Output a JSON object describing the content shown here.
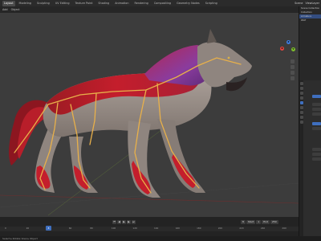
{
  "topbar": {
    "tabs": [
      "Layout",
      "Modeling",
      "Sculpting",
      "UV Editing",
      "Texture Paint",
      "Shading",
      "Animation",
      "Rendering",
      "Compositing",
      "Geometry Nodes",
      "Scripting"
    ],
    "active_tab": 0,
    "scene_label": "Scene",
    "layer_label": "ViewLayer"
  },
  "viewport_header": {
    "items": [
      "Add",
      "Object"
    ]
  },
  "gizmo": {
    "x": "X",
    "y": "Y",
    "z": "Z",
    "colors": {
      "x": "#e2463f",
      "y": "#7ebd2e",
      "z": "#3f7ee2"
    }
  },
  "timeline": {
    "current_frame": "8",
    "start_label": "Start",
    "start": "1",
    "end_label": "End",
    "end": "250",
    "ticks": [
      "0",
      "20",
      "40",
      "60",
      "80",
      "100",
      "120",
      "140",
      "160",
      "180",
      "200",
      "220",
      "240",
      "260"
    ]
  },
  "outliner": {
    "rows": [
      "Scene Collection",
      "Collection",
      "Armature",
      "Wolf"
    ]
  },
  "status": {
    "text": "Select ▸ Rotate View ▸ Object"
  },
  "colors": {
    "viewport_bg": "#3c3c3c",
    "bone": "#e8b04a",
    "fur_red": "#c41e2c",
    "fur_gray": "#8f857f",
    "mane_purple": "#8a3c9e",
    "accent_blue": "#3f6fbf"
  }
}
